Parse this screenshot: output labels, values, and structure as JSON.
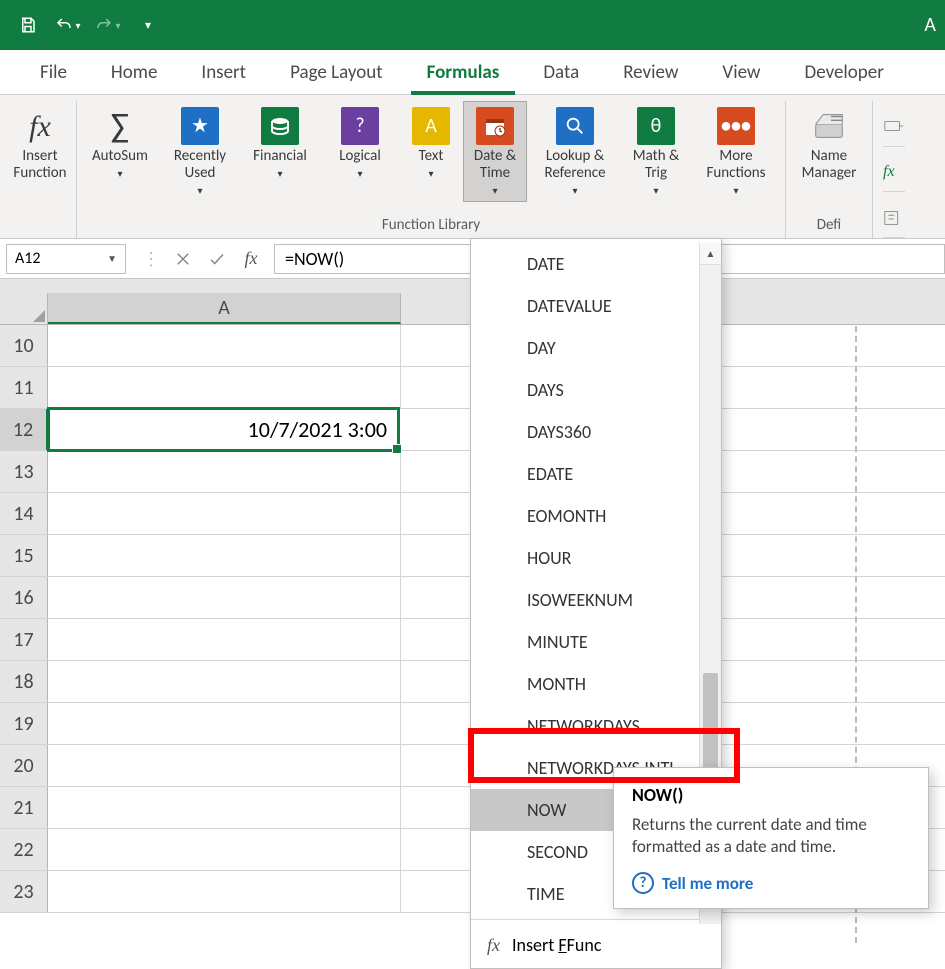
{
  "titlebar": {
    "right_text": "A"
  },
  "tabs": {
    "file": "File",
    "home": "Home",
    "insert": "Insert",
    "page_layout": "Page Layout",
    "formulas": "Formulas",
    "data": "Data",
    "review": "Review",
    "view": "View",
    "developer": "Developer",
    "active": "formulas"
  },
  "ribbon": {
    "insert_function": "Insert Function",
    "autosum": "AutoSum",
    "recently_used": "Recently Used",
    "financial": "Financial",
    "logical": "Logical",
    "text": "Text",
    "date_time": "Date & Time",
    "lookup_ref": "Lookup & Reference",
    "math_trig": "Math & Trig",
    "more_functions": "More Functions",
    "name_manager": "Name Manager",
    "group_function_library": "Function Library",
    "group_defined": "Defi"
  },
  "namebox": "A12",
  "formula": "=NOW()",
  "columns": {
    "A": "A"
  },
  "rows": [
    10,
    11,
    12,
    13,
    14,
    15,
    16,
    17,
    18,
    19,
    20,
    21,
    22,
    23
  ],
  "active_row": 12,
  "cell_value": "10/7/2021 3:00",
  "date_time_menu": {
    "items": [
      "DATE",
      "DATEVALUE",
      "DAY",
      "DAYS",
      "DAYS360",
      "EDATE",
      "EOMONTH",
      "HOUR",
      "ISOWEEKNUM",
      "MINUTE",
      "MONTH",
      "NETWORKDAYS",
      "NETWORKDAYS.INTL",
      "NOW",
      "SECOND",
      "TIME"
    ],
    "hovered": "NOW",
    "insert_function_prefix": "Insert ",
    "insert_function_word": "Func"
  },
  "tooltip": {
    "title": "NOW()",
    "body": "Returns the current date and time formatted as a date and time.",
    "link": "Tell me more"
  }
}
